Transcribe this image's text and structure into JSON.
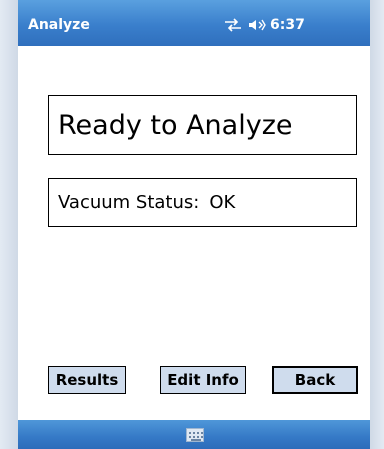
{
  "title_bar": {
    "title": "Analyze",
    "time": "6:37",
    "connectivity_icon": "connectivity-icon",
    "volume_icon": "volume-icon"
  },
  "main": {
    "status_text": "Ready to Analyze",
    "vacuum_label": "Vacuum Status:",
    "vacuum_value": "OK"
  },
  "buttons": {
    "results_label": "Results",
    "edit_info_label": "Edit Info",
    "back_label": "Back"
  },
  "bottom_bar": {
    "keyboard_icon": "keyboard-icon"
  },
  "colors": {
    "title_bar": "#3a7fcc",
    "button_bg": "#cfdced",
    "frame": "#cfd9e6"
  }
}
